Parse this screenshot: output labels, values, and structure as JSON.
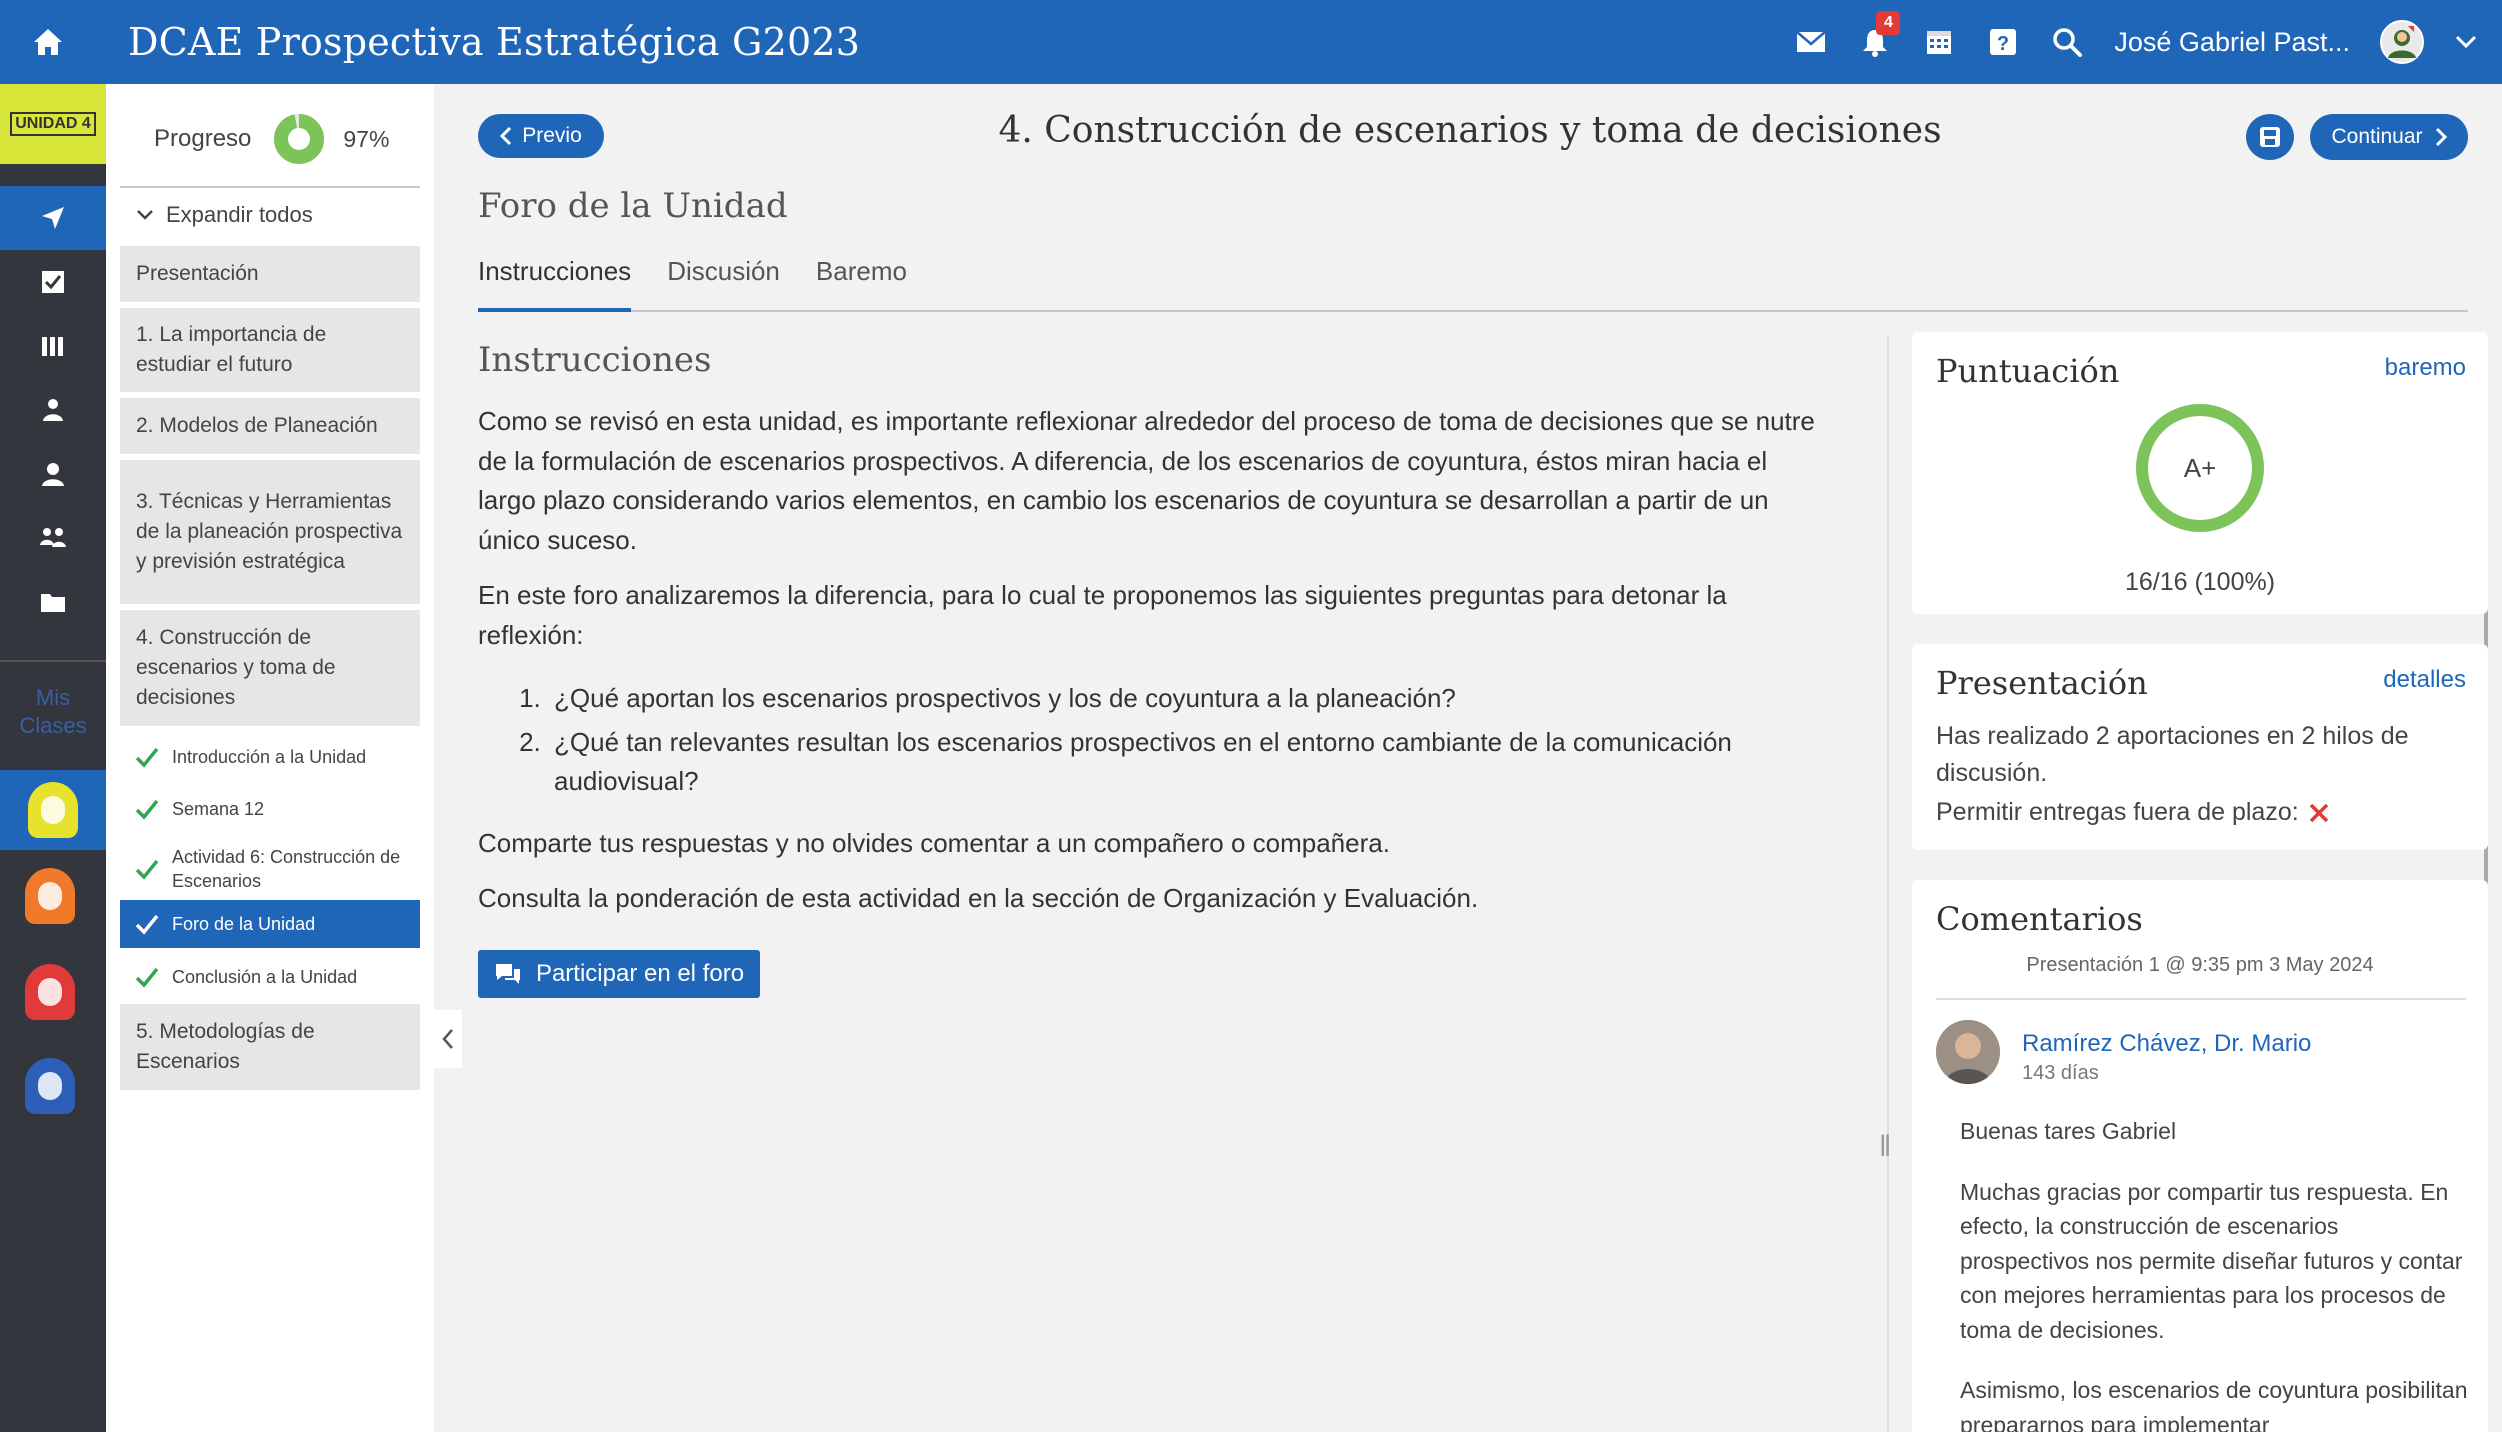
{
  "app": {
    "title": "DCAE Prospectiva Estratégica G2023"
  },
  "topbar": {
    "notification_count": "4",
    "user_name": "José Gabriel Past..."
  },
  "rail": {
    "unit_badge": "UNIDAD 4",
    "label": "Mis Clases",
    "head_colors": [
      "#e6e22e",
      "#f07a2a",
      "#e03a3a",
      "#2d5fb8"
    ]
  },
  "outline": {
    "progress_label": "Progreso",
    "progress_value": 0.97,
    "progress_text": "97%",
    "expand_label": "Expandir todos",
    "items": [
      "Presentación",
      "1. La importancia de estudiar el futuro",
      "2. Modelos de Planeación",
      "3. Técnicas y Herramientas de la planeación prospectiva y previsión estratégica",
      "4. Construcción de escenarios y toma de decisiones"
    ],
    "subitems": [
      "Introducción a la Unidad",
      "Semana 12",
      "Actividad 6: Construcción de Escenarios",
      "Foro de la Unidad",
      "Conclusión a la Unidad"
    ],
    "last_item": "5. Metodologías de Escenarios"
  },
  "header": {
    "prev_label": "Previo",
    "page_title": "4. Construcción de escenarios y toma de decisiones",
    "continue_label": "Continuar",
    "sub_title": "Foro de la Unidad"
  },
  "tabs": [
    "Instrucciones",
    "Discusión",
    "Baremo"
  ],
  "instructions": {
    "heading": "Instrucciones",
    "p1": "Como se revisó en esta unidad, es importante reflexionar alrededor del proceso de toma de decisiones que se nutre de la formulación de escenarios prospectivos. A diferencia, de los escenarios de coyuntura, éstos miran hacia el largo plazo considerando varios elementos, en cambio los escenarios de coyuntura se desarrollan a partir de un único suceso.",
    "p2": "En este foro analizaremos la diferencia, para lo cual te proponemos las siguientes preguntas para detonar la reflexión:",
    "q1": "¿Qué aportan los escenarios prospectivos y los de coyuntura a la planeación?",
    "q2": "¿Qué tan relevantes resultan los escenarios prospectivos en el entorno cambiante de la comunicación audiovisual?",
    "p3": "Comparte tus respuestas y no olvides comentar a un compañero o compañera.",
    "p4": "Consulta la ponderación de esta actividad en la sección de Organización y Evaluación.",
    "button": "Participar en el foro"
  },
  "score_card": {
    "title": "Puntuación",
    "link": "baremo",
    "grade": "A+",
    "score": "16/16 (100%)",
    "percent": 1.0,
    "color": "#7cc35a"
  },
  "presentation_card": {
    "title": "Presentación",
    "link": "detalles",
    "text": "Has realizado 2 aportaciones en 2 hilos de discusión.",
    "late_label": "Permitir entregas fuera de plazo:"
  },
  "comments_card": {
    "title": "Comentarios",
    "meta": "Presentación 1 @ 9:35 pm 3 May 2024",
    "author": "Ramírez Chávez, Dr. Mario",
    "time": "143 días",
    "greeting": "Buenas tares Gabriel",
    "body1": "Muchas gracias por compartir tus respuesta. En efecto, la construcción de escenarios prospectivos nos permite diseñar futuros y contar con mejores herramientas para los procesos de toma de decisiones.",
    "body2": "Asimismo, los escenarios de coyuntura posibilitan prepararnos para implementar"
  }
}
